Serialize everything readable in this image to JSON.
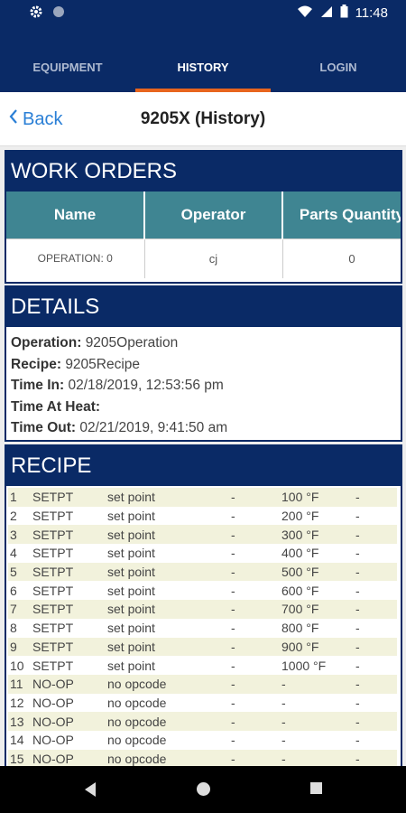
{
  "status_bar": {
    "time": "11:48",
    "left_icons": [
      "gear-icon",
      "circle-icon"
    ],
    "right_icons": [
      "wifi-icon",
      "signal-icon",
      "battery-icon"
    ]
  },
  "tabs": [
    {
      "label": "EQUIPMENT",
      "active": false
    },
    {
      "label": "HISTORY",
      "active": true
    },
    {
      "label": "LOGIN",
      "active": false
    }
  ],
  "header": {
    "back_label": "Back",
    "title": "9205X (History)"
  },
  "work_orders": {
    "title": "WORK ORDERS",
    "columns": [
      "Name",
      "Operator",
      "Parts Quantity"
    ],
    "rows": [
      {
        "name": "OPERATION: 0",
        "operator": "cj",
        "parts_quantity": "0"
      }
    ]
  },
  "details": {
    "title": "DETAILS",
    "fields": [
      {
        "label": "Operation:",
        "value": "9205Operation"
      },
      {
        "label": "Recipe:",
        "value": "9205Recipe"
      },
      {
        "label": "Time In:",
        "value": "02/18/2019, 12:53:56 pm"
      },
      {
        "label": "Time At Heat:",
        "value": ""
      },
      {
        "label": "Time Out:",
        "value": "02/21/2019, 9:41:50 am"
      }
    ]
  },
  "recipe": {
    "title": "RECIPE",
    "rows": [
      {
        "num": "1",
        "code": "SETPT",
        "desc": "set point",
        "d1": "-",
        "value": "100 °F",
        "d2": "-"
      },
      {
        "num": "2",
        "code": "SETPT",
        "desc": "set point",
        "d1": "-",
        "value": "200 °F",
        "d2": "-"
      },
      {
        "num": "3",
        "code": "SETPT",
        "desc": "set point",
        "d1": "-",
        "value": "300 °F",
        "d2": "-"
      },
      {
        "num": "4",
        "code": "SETPT",
        "desc": "set point",
        "d1": "-",
        "value": "400 °F",
        "d2": "-"
      },
      {
        "num": "5",
        "code": "SETPT",
        "desc": "set point",
        "d1": "-",
        "value": "500 °F",
        "d2": "-"
      },
      {
        "num": "6",
        "code": "SETPT",
        "desc": "set point",
        "d1": "-",
        "value": "600 °F",
        "d2": "-"
      },
      {
        "num": "7",
        "code": "SETPT",
        "desc": "set point",
        "d1": "-",
        "value": "700 °F",
        "d2": "-"
      },
      {
        "num": "8",
        "code": "SETPT",
        "desc": "set point",
        "d1": "-",
        "value": "800 °F",
        "d2": "-"
      },
      {
        "num": "9",
        "code": "SETPT",
        "desc": "set point",
        "d1": "-",
        "value": "900 °F",
        "d2": "-"
      },
      {
        "num": "10",
        "code": "SETPT",
        "desc": "set point",
        "d1": "-",
        "value": "1000 °F",
        "d2": "-"
      },
      {
        "num": "11",
        "code": "NO-OP",
        "desc": "no opcode",
        "d1": "-",
        "value": "-",
        "d2": "-"
      },
      {
        "num": "12",
        "code": "NO-OP",
        "desc": "no opcode",
        "d1": "-",
        "value": "-",
        "d2": "-"
      },
      {
        "num": "13",
        "code": "NO-OP",
        "desc": "no opcode",
        "d1": "-",
        "value": "-",
        "d2": "-"
      },
      {
        "num": "14",
        "code": "NO-OP",
        "desc": "no opcode",
        "d1": "-",
        "value": "-",
        "d2": "-"
      },
      {
        "num": "15",
        "code": "NO-OP",
        "desc": "no opcode",
        "d1": "-",
        "value": "-",
        "d2": "-"
      }
    ]
  },
  "nav_bar": {
    "buttons": [
      "back-triangle-icon",
      "home-circle-icon",
      "recents-square-icon"
    ]
  },
  "colors": {
    "primary": "#0a2a66",
    "tab_indicator": "#e8651e",
    "table_header": "#3f8592",
    "link": "#2a7fd6",
    "row_stripe": "#f2f2dc"
  }
}
